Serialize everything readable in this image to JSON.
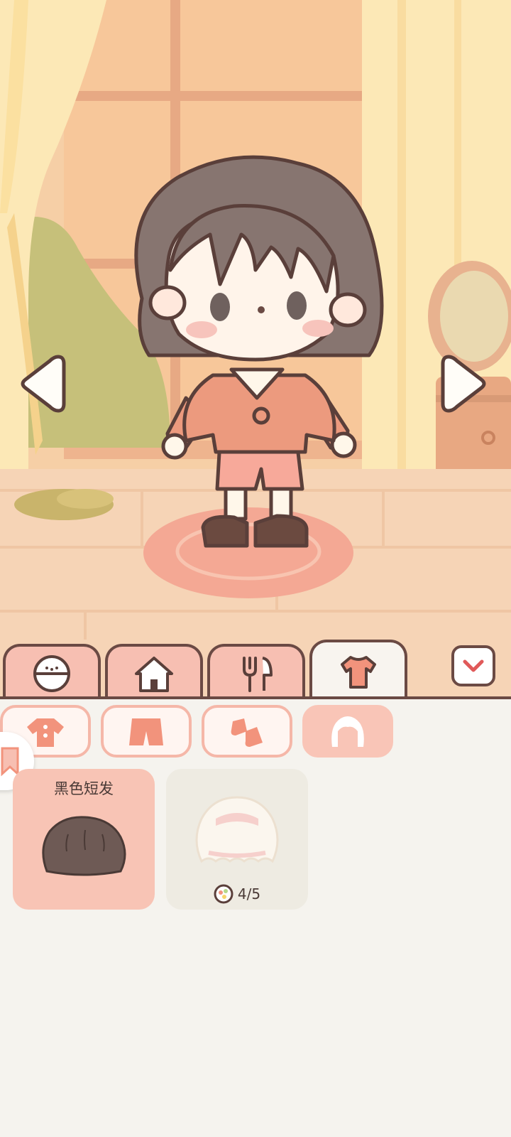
{
  "scene": {
    "location": "bedroom"
  },
  "tabs": [
    {
      "icon": "face-icon"
    },
    {
      "icon": "house-icon"
    },
    {
      "icon": "fork-knife-icon"
    },
    {
      "icon": "shirt-icon",
      "active": true
    }
  ],
  "collapse_icon": "chevron-down-icon",
  "subtabs": [
    {
      "icon": "top-icon"
    },
    {
      "icon": "shorts-icon"
    },
    {
      "icon": "shoes-icon"
    },
    {
      "icon": "hair-icon",
      "active": true
    }
  ],
  "items": [
    {
      "label": "黑色短发",
      "selected": true
    },
    {
      "label": "",
      "cost": "4/5",
      "locked": true
    }
  ],
  "colors": {
    "accent": "#f8c4b5",
    "outline": "#6b4a44",
    "panel": "#f5f3ee"
  }
}
